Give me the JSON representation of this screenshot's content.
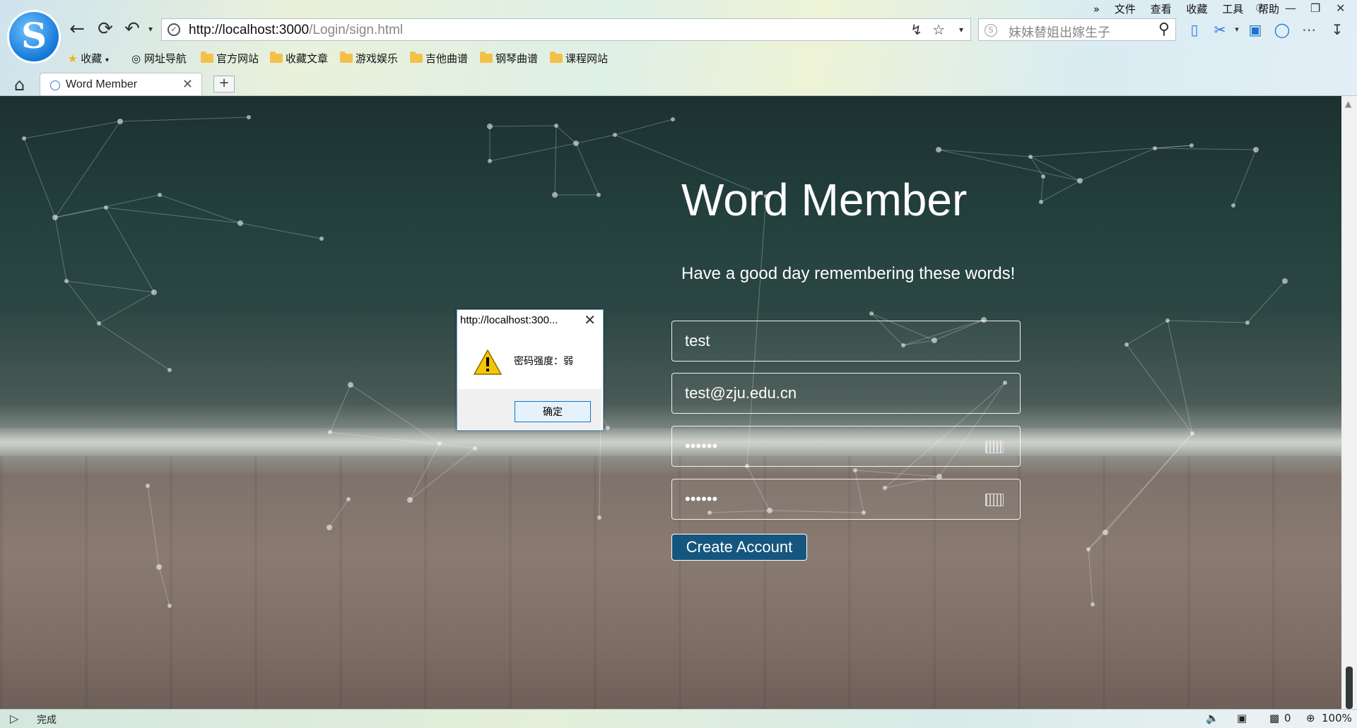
{
  "browser": {
    "menu": [
      "文件",
      "查看",
      "收藏",
      "工具",
      "帮助"
    ],
    "url_host": "http://localhost:3000",
    "url_path": "/Login/sign.html",
    "search_placeholder": "妹妹替姐出嫁生子",
    "bookmarks": [
      {
        "label": "收藏",
        "icon": "star-icon"
      },
      {
        "label": "网址导航",
        "icon": "globe-icon"
      },
      {
        "label": "官方网站",
        "icon": "folder-icon"
      },
      {
        "label": "收藏文章",
        "icon": "folder-icon"
      },
      {
        "label": "游戏娱乐",
        "icon": "folder-icon"
      },
      {
        "label": "吉他曲谱",
        "icon": "folder-icon"
      },
      {
        "label": "钢琴曲谱",
        "icon": "folder-icon"
      },
      {
        "label": "课程网站",
        "icon": "folder-icon"
      }
    ],
    "tab_title": "Word Member",
    "status_text": "完成",
    "status_count": "0",
    "zoom": "100%"
  },
  "page": {
    "heading": "Word Member",
    "tagline": "Have a good day remembering these words!",
    "username_value": "test",
    "email_value": "test@zju.edu.cn",
    "password_value": "123456",
    "confirm_value": "123456",
    "create_button": "Create Account"
  },
  "dialog": {
    "title": "http://localhost:300...",
    "message": "密码强度：弱",
    "ok_button": "确定"
  },
  "colors": {
    "button": "#15567e",
    "dialog_border": "#0078d7"
  }
}
